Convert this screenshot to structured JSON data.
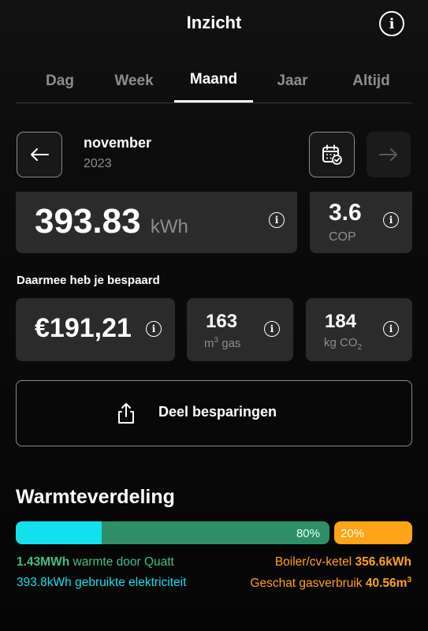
{
  "header": {
    "title": "Inzicht"
  },
  "tabs": [
    {
      "label": "Dag"
    },
    {
      "label": "Week"
    },
    {
      "label": "Maand"
    },
    {
      "label": "Jaar"
    },
    {
      "label": "Altijd"
    }
  ],
  "active_tab": "Maand",
  "period": {
    "month": "november",
    "year": "2023"
  },
  "energy": {
    "value": "393.83",
    "unit": "kWh"
  },
  "cop": {
    "value": "3.6",
    "label": "COP"
  },
  "savings": {
    "heading": "Daarmee heb je bespaard",
    "money": "€191,21",
    "gas_value": "163",
    "gas_unit_prefix": "m",
    "gas_unit_sup": "3",
    "gas_unit_suffix": " gas",
    "co2_value": "184",
    "co2_unit_prefix": "kg CO",
    "co2_unit_sub": "2"
  },
  "share": {
    "label": "Deel besparingen"
  },
  "distribution": {
    "title": "Warmteverdeling",
    "quatt_fraction": 0.8,
    "quatt_pct": "80%",
    "boiler_pct": "20%",
    "electricity_fraction_of_bar": 0.275,
    "heat_quatt_value": "1.43MWh",
    "heat_quatt_text": " warmte door Quatt",
    "electricity_text": "393.8kWh gebruikte elektriciteit",
    "boiler_text": "Boiler/cv-ketel ",
    "boiler_value": "356.6kWh",
    "gas_est_text": "Geschat gasverbruik ",
    "gas_est_value": "40.56m",
    "gas_est_sup": "3"
  },
  "colors": {
    "quatt_green": "#2d8f66",
    "legend_green": "#3fbf86",
    "electricity_cyan": "#12e0ee",
    "boiler_orange": "#ffa318"
  },
  "icons": [
    "info-icon",
    "arrow-left-icon",
    "calendar-check-icon",
    "arrow-right-icon",
    "share-icon"
  ]
}
